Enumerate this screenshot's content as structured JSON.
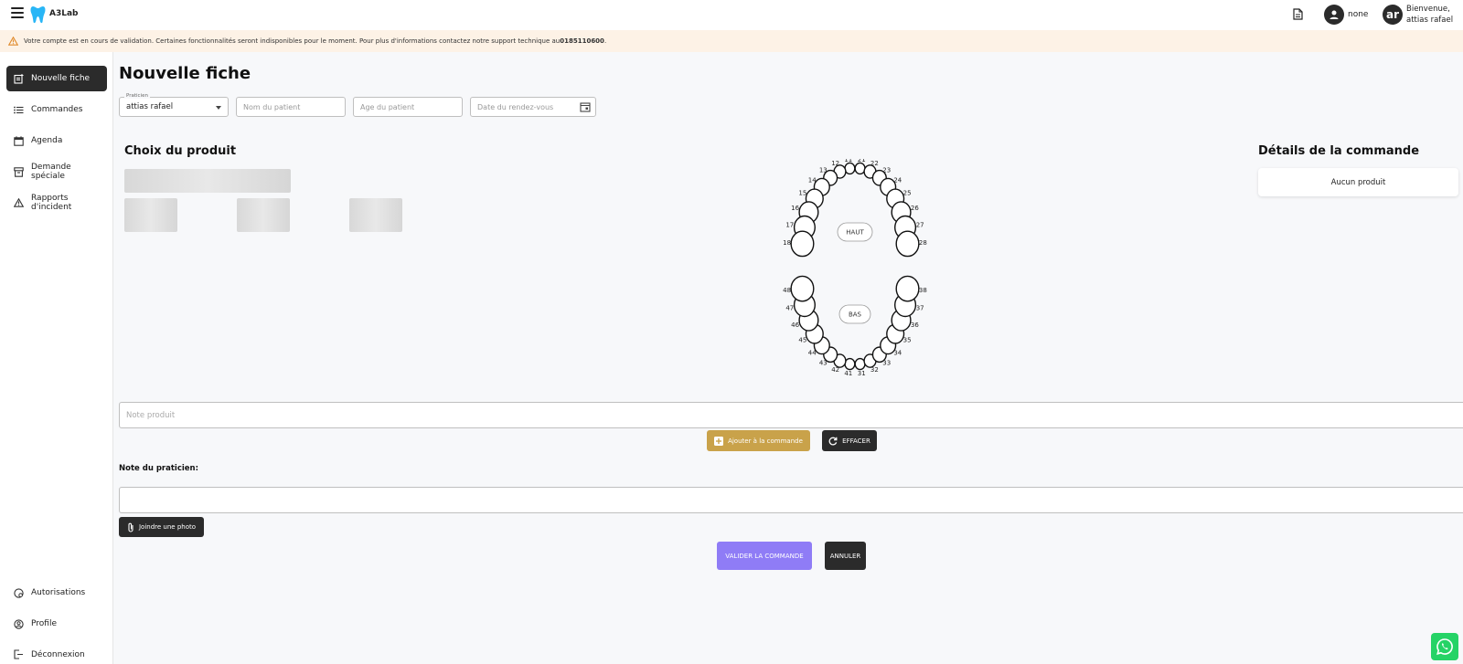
{
  "header": {
    "brand": "A3Lab",
    "user_label": "none",
    "avatar_initials": "ar",
    "welcome_line1": "Bienvenue,",
    "welcome_line2": "attias rafael"
  },
  "banner": {
    "message": "Votre compte est en cours de validation. Certaines fonctionnalités seront indisponibles pour le moment. Pour plus d'informations contactez notre support technique au ",
    "phone": "0185110600",
    "suffix": "."
  },
  "sidebar": {
    "items": [
      {
        "label": "Nouvelle fiche",
        "icon": "note-add-icon",
        "active": true
      },
      {
        "label": "Commandes",
        "icon": "list-icon"
      },
      {
        "label": "Agenda",
        "icon": "calendar-icon"
      },
      {
        "label": "Demande spéciale",
        "icon": "archive-icon"
      },
      {
        "label": "Rapports d'incident",
        "icon": "warning-icon"
      }
    ],
    "bottom_items": [
      {
        "label": "Autorisations",
        "icon": "permissions-icon"
      },
      {
        "label": "Profile",
        "icon": "profile-icon"
      },
      {
        "label": "Déconnexion",
        "icon": "logout-icon"
      }
    ]
  },
  "main": {
    "title": "Nouvelle fiche",
    "form": {
      "praticien_legend": "Praticien",
      "praticien_value": "attias rafael",
      "nom_placeholder": "Nom du patient",
      "age_placeholder": "Age du patient",
      "date_placeholder": "Date du rendez-vous"
    },
    "product_section_title": "Choix du produit",
    "details_title": "Détails de la commande",
    "details_empty": "Aucun produit",
    "tooth_chart": {
      "upper_label": "HAUT",
      "lower_label": "BAS",
      "upper_teeth": [
        "11",
        "12",
        "13",
        "14",
        "15",
        "16",
        "17",
        "18",
        "21",
        "22",
        "23",
        "24",
        "25",
        "26",
        "27",
        "28"
      ],
      "lower_teeth": [
        "31",
        "32",
        "33",
        "34",
        "35",
        "36",
        "37",
        "38",
        "41",
        "42",
        "43",
        "44",
        "45",
        "46",
        "47",
        "48"
      ]
    },
    "note_produit_placeholder": "Note produit",
    "add_button": "Ajouter à la commande",
    "clear_button": "EFFACER",
    "note_praticien_label": "Note du praticien:",
    "attach_button": "Joindre une photo",
    "validate_button": "VALIDER LA COMMANDE",
    "cancel_button": "ANNULER"
  },
  "colors": {
    "dark": "#2b2b2b",
    "gold": "#c9a24a",
    "purple": "#8f7cf6",
    "banner_bg": "#fdf2e6",
    "whatsapp": "#25d366",
    "logo_blue": "#29b6f6"
  }
}
